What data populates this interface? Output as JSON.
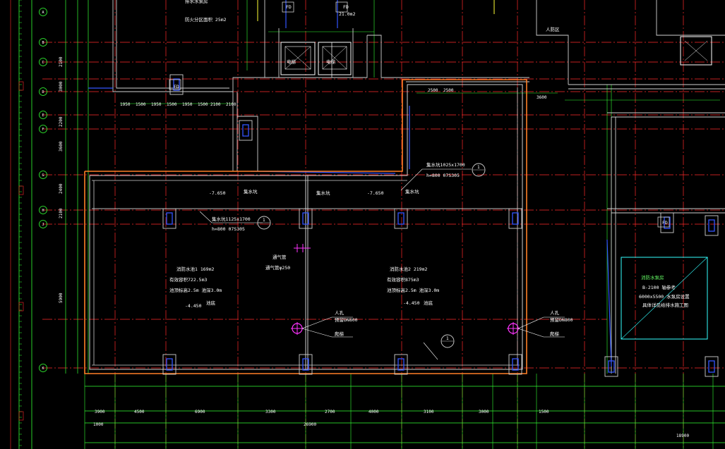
{
  "drawing": {
    "colors": {
      "background": "#000000",
      "axis": "#ff2a2a",
      "wall": "#cfcfcf",
      "outline": "#ff7f27",
      "dimension": "#33ff33",
      "blue": "#3355ff",
      "magenta": "#ff33ff",
      "cyan": "#33ffff",
      "yellow": "#ffff33"
    },
    "left_axis_bubbles": [
      "A",
      "B",
      "C",
      "D",
      "E",
      "F",
      "G",
      "H",
      "J",
      "K"
    ],
    "top_dims": [
      "1950",
      "1500",
      "1950",
      "1500",
      "1950",
      "1500",
      "2100",
      "2100",
      "2500",
      "2500",
      "3600"
    ],
    "bottom_dims_row1": [
      "3900",
      "4500",
      "6900",
      "3300",
      "2700",
      "4000",
      "3100",
      "3000",
      "1500"
    ],
    "bottom_total_left": "1000",
    "bottom_total_mid": "26900",
    "bottom_total_right": "18900",
    "left_dims": [
      "2100",
      "3000",
      "2200",
      "3600",
      "2400",
      "2100",
      "5900"
    ],
    "notes": [
      {
        "text": "集水坑1025x1700",
        "cls": "note"
      },
      {
        "text": "h=800 07S305",
        "cls": "note"
      },
      {
        "text": "集水坑1125x1700",
        "cls": "note"
      },
      {
        "text": "h=800 07S305",
        "cls": "note"
      },
      {
        "text": "消防水池1   169m2",
        "cls": "note"
      },
      {
        "text": "有效容积722.5m3",
        "cls": "note"
      },
      {
        "text": "池顶标高2.5m 池深3.0m",
        "cls": "note"
      },
      {
        "text": "消防水池2   219m2",
        "cls": "note"
      },
      {
        "text": "有效容积875m3",
        "cls": "note"
      },
      {
        "text": "池顶标高2.5m 池深3.0m",
        "cls": "note"
      },
      {
        "text": "-4.450",
        "cls": "note"
      },
      {
        "text": "池底",
        "cls": "note"
      },
      {
        "text": "-4.450",
        "cls": "note"
      },
      {
        "text": "池底",
        "cls": "note"
      },
      {
        "text": "通气管",
        "cls": "note"
      },
      {
        "text": "通气管φ250",
        "cls": "note"
      },
      {
        "text": "人孔",
        "cls": "note"
      },
      {
        "text": "预留DN800",
        "cls": "note"
      },
      {
        "text": "爬梯",
        "cls": "note"
      },
      {
        "text": "人孔",
        "cls": "note"
      },
      {
        "text": "预留DN800",
        "cls": "note"
      },
      {
        "text": "爬梯",
        "cls": "note"
      },
      {
        "text": "-7.650",
        "cls": "note"
      },
      {
        "text": "集水坑",
        "cls": "note"
      },
      {
        "text": "-7.650",
        "cls": "note"
      },
      {
        "text": "集水坑",
        "cls": "note"
      },
      {
        "text": "集水坑",
        "cls": "note"
      },
      {
        "text": "消防水泵房",
        "cls": "note-g"
      },
      {
        "text": "B-2100 轴参考",
        "cls": "note"
      },
      {
        "text": "6000x5500 水泵房设置",
        "cls": "note"
      },
      {
        "text": "具体详见给排水施工图",
        "cls": "note"
      },
      {
        "text": "FD",
        "cls": "note"
      },
      {
        "text": "FD",
        "cls": "note"
      },
      {
        "text": "FD",
        "cls": "note"
      },
      {
        "text": "FD",
        "cls": "note"
      },
      {
        "text": "21.0m2",
        "cls": "note"
      },
      {
        "text": "排水水泵房",
        "cls": "note"
      },
      {
        "text": "防火分区面积 25m2",
        "cls": "note"
      },
      {
        "text": "人防区",
        "cls": "note"
      },
      {
        "text": "电梯",
        "cls": "note"
      },
      {
        "text": "电梯",
        "cls": "note"
      }
    ],
    "callouts": [
      "1",
      "1",
      "1",
      "1"
    ],
    "section_marks": [
      "1",
      "1"
    ]
  }
}
